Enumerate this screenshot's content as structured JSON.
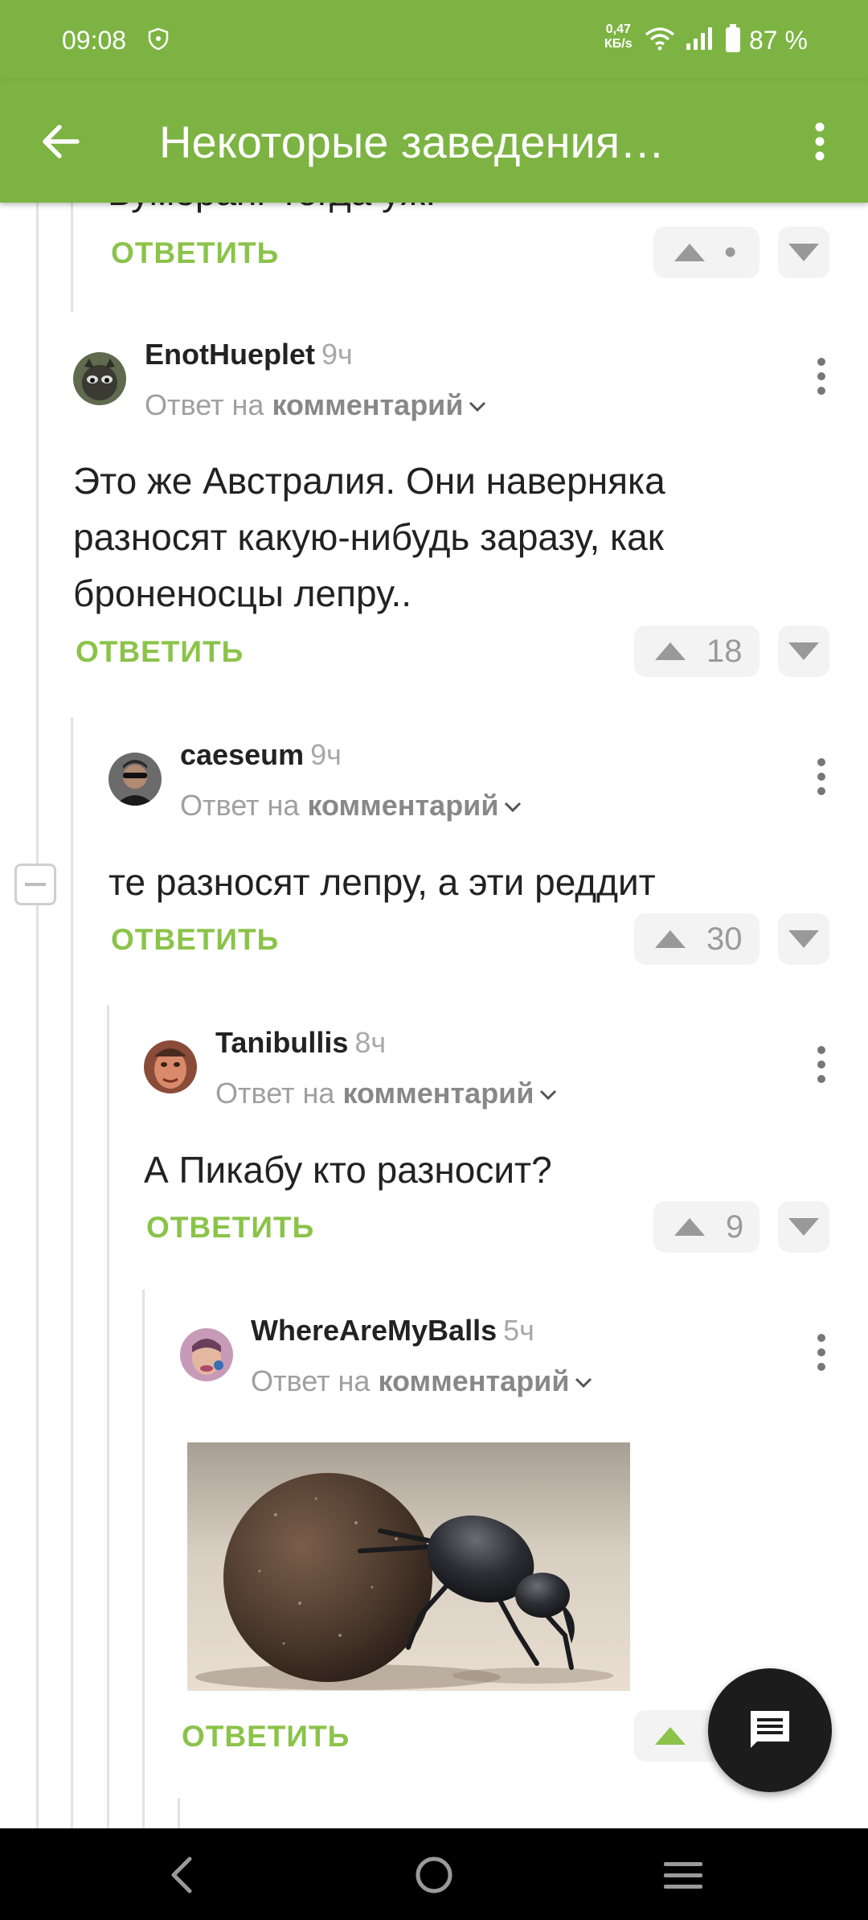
{
  "status": {
    "time": "09:08",
    "net_speed_value": "0,47",
    "net_speed_unit": "КБ/s",
    "battery": "87 %"
  },
  "appbar": {
    "title": "Некоторые заведения…"
  },
  "comments": [
    {
      "partial_text": "Бумеранг тогда уж.",
      "reply_label": "ОТВЕТИТЬ",
      "rating": "•"
    },
    {
      "author": "EnotHueplet",
      "time_ago": "9ч",
      "reply_to_prefix": "Ответ на",
      "reply_to_link": "комментарий",
      "text": "Это же Австралия. Они наверняка разносят какую-нибудь заразу, как броненосцы лепру..",
      "reply_label": "ОТВЕТИТЬ",
      "rating": "18"
    },
    {
      "author": "caeseum",
      "time_ago": "9ч",
      "reply_to_prefix": "Ответ на",
      "reply_to_link": "комментарий",
      "text": "те разносят лепру, а эти реддит",
      "reply_label": "ОТВЕТИТЬ",
      "rating": "30"
    },
    {
      "author": "Tanibullis",
      "time_ago": "8ч",
      "reply_to_prefix": "Ответ на",
      "reply_to_link": "комментарий",
      "text": "А Пикабу кто разносит?",
      "reply_label": "ОТВЕТИТЬ",
      "rating": "9"
    },
    {
      "author": "WhereAreMyBalls",
      "time_ago": "5ч",
      "reply_to_prefix": "Ответ на",
      "reply_to_link": "комментарий",
      "image": "dung-beetle-rolling-ball",
      "reply_label": "ОТВЕТИТЬ",
      "rating": ""
    }
  ],
  "colors": {
    "brand_green": "#7cb342",
    "link_green": "#8bc34a",
    "fab": "#1c1c1c"
  },
  "icons": [
    "back-arrow-icon",
    "more-vert-icon",
    "upvote-icon",
    "downvote-icon",
    "chevron-down-icon",
    "comment-icon",
    "nav-back-icon",
    "nav-home-icon",
    "nav-recents-icon"
  ]
}
